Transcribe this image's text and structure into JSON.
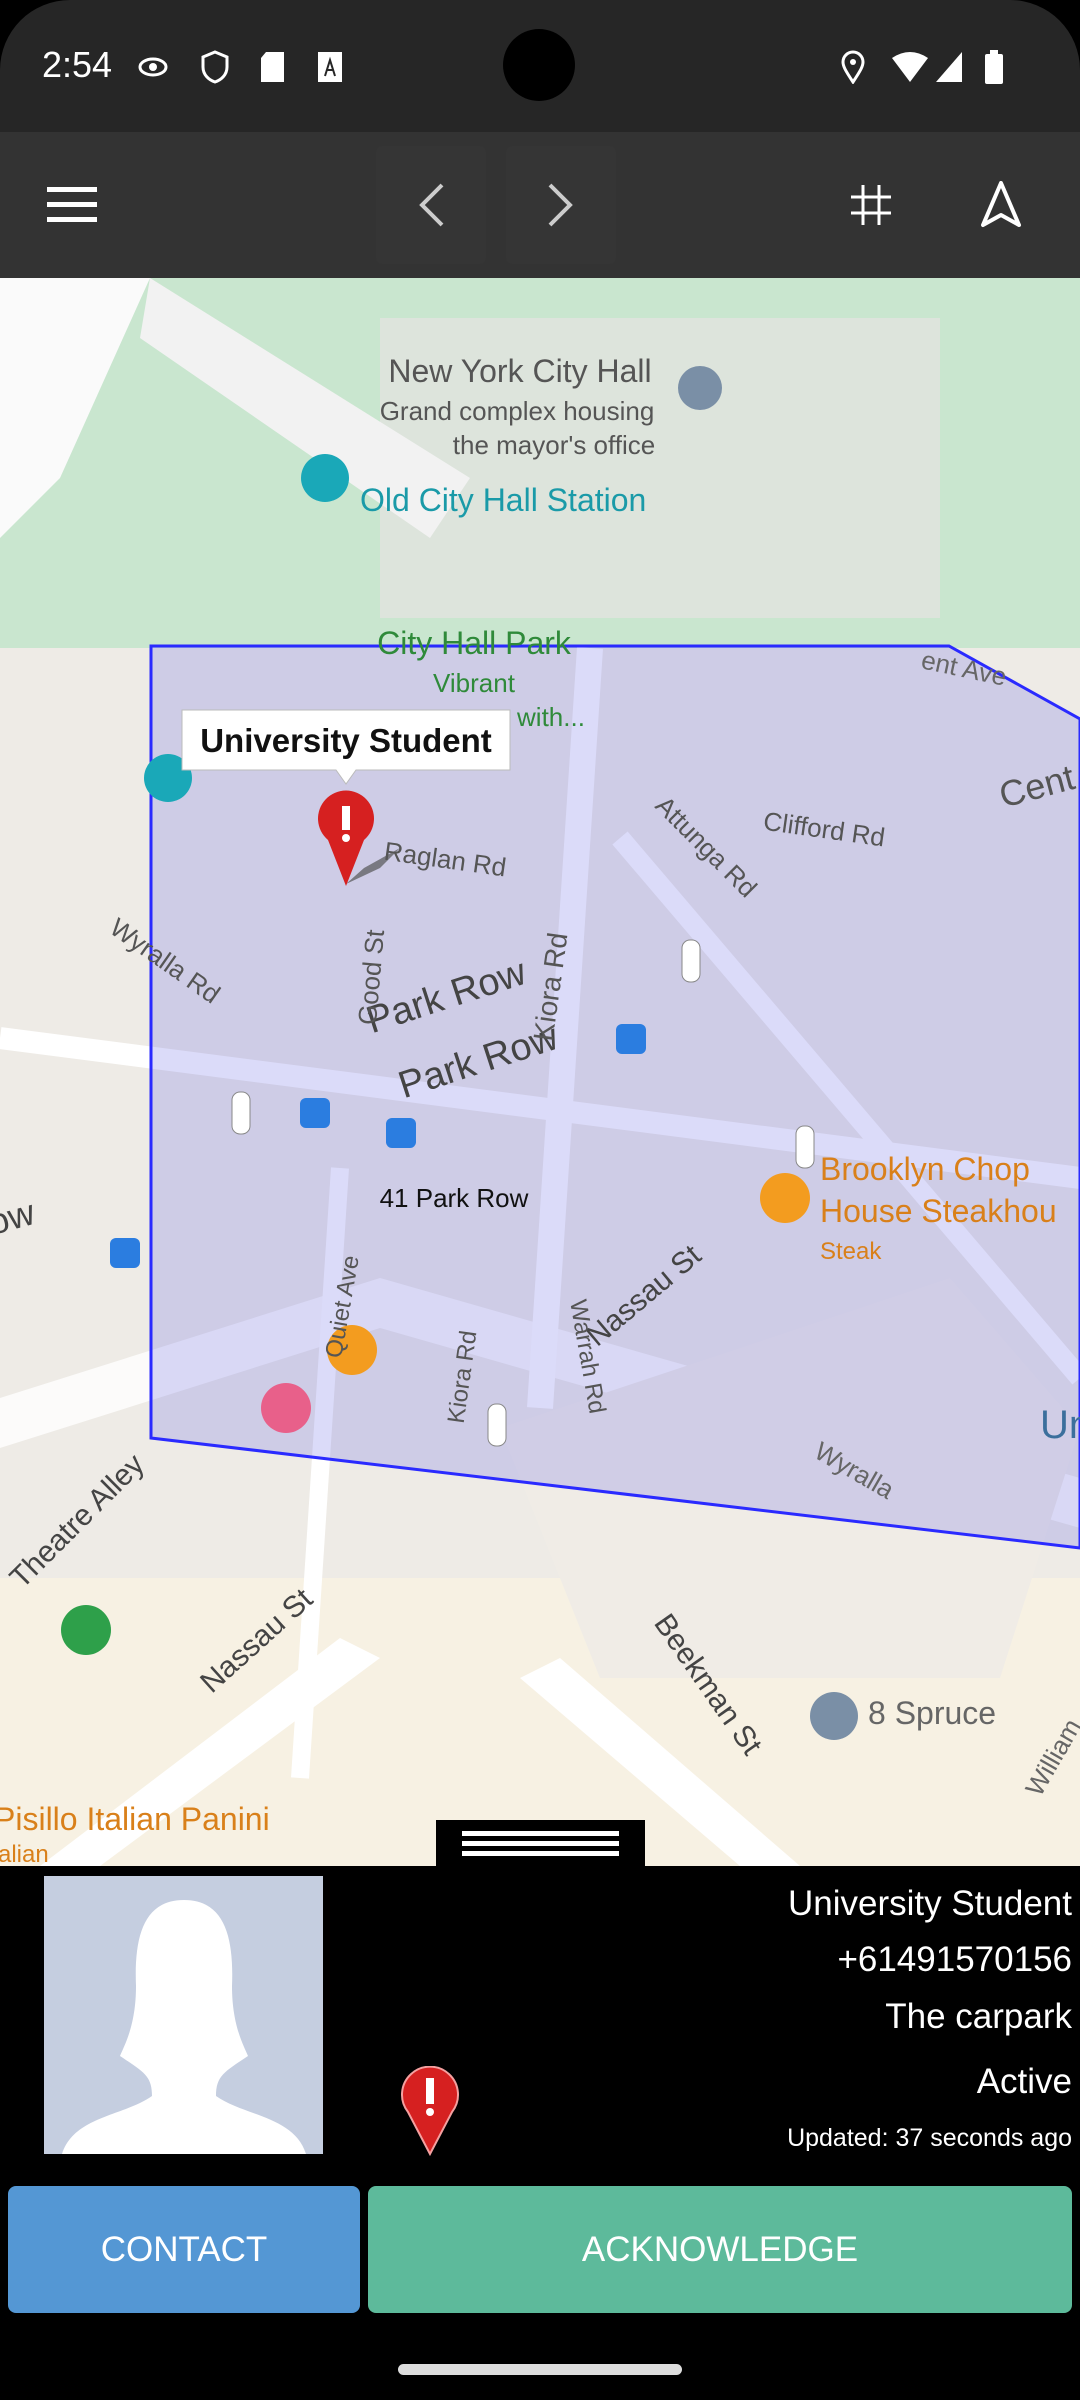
{
  "status_bar": {
    "time": "2:54",
    "icons_left": [
      "eye-icon",
      "shield-icon",
      "sd-card-icon",
      "a-badge-icon"
    ],
    "icons_right": [
      "location-icon",
      "wifi-icon",
      "signal-icon",
      "battery-icon"
    ]
  },
  "toolbar": {
    "icons": [
      "menu-icon",
      "chevron-left-icon",
      "chevron-right-icon",
      "grid-icon",
      "navigation-arrow-icon"
    ]
  },
  "map": {
    "labels": {
      "city_hall": "New York City Hall",
      "city_hall_desc1": "Grand complex housing",
      "city_hall_desc2": "the mayor's office",
      "station": "Old City Hall Station",
      "park": "City Hall Park",
      "park_desc1": "Vibrant",
      "park_desc2": "with...",
      "raglan": "Raglan Rd",
      "clifford": "Clifford Rd",
      "attunga": "Attunga Rd",
      "wyralla": "Wyralla Rd",
      "wyralla2": "Wyralla",
      "park_row1": "Park Row",
      "park_row2": "Park Row",
      "kiora1": "Kiora Rd",
      "kiora2": "Kiora Rd",
      "good": "Good St",
      "cent": "Cent",
      "address": "41 Park Row",
      "brooklyn1": "Brooklyn Chop",
      "brooklyn2": "House Steakhou",
      "steak": "Steak",
      "nassau1": "Nassau St",
      "nassau2": "Nassau St",
      "warrah": "Warrah Rd",
      "theatre": "Theatre Alley",
      "beekman": "Beekman St",
      "spruce": "8 Spruce",
      "pisillo": "Pisillo Italian Panini",
      "italian": "alian",
      "un": "Un",
      "row": "ow",
      "quiet": "Quiet Ave",
      "ent_ave": "ent Ave",
      "william": "William"
    },
    "marker_tooltip": "University Student",
    "colors": {
      "geofence": "#2a2aff",
      "label_orange": "#d9801a",
      "label_teal": "#1a9aa8",
      "label_green": "#2f8a3a"
    }
  },
  "panel": {
    "name": "University Student",
    "phone": "+61491570156",
    "location": "The carpark",
    "state": "Active",
    "updated": "Updated: 37 seconds ago",
    "contact_label": "CONTACT",
    "acknowledge_label": "ACKNOWLEDGE",
    "colors": {
      "contact": "#5497d4",
      "acknowledge": "#5dba9b"
    }
  }
}
